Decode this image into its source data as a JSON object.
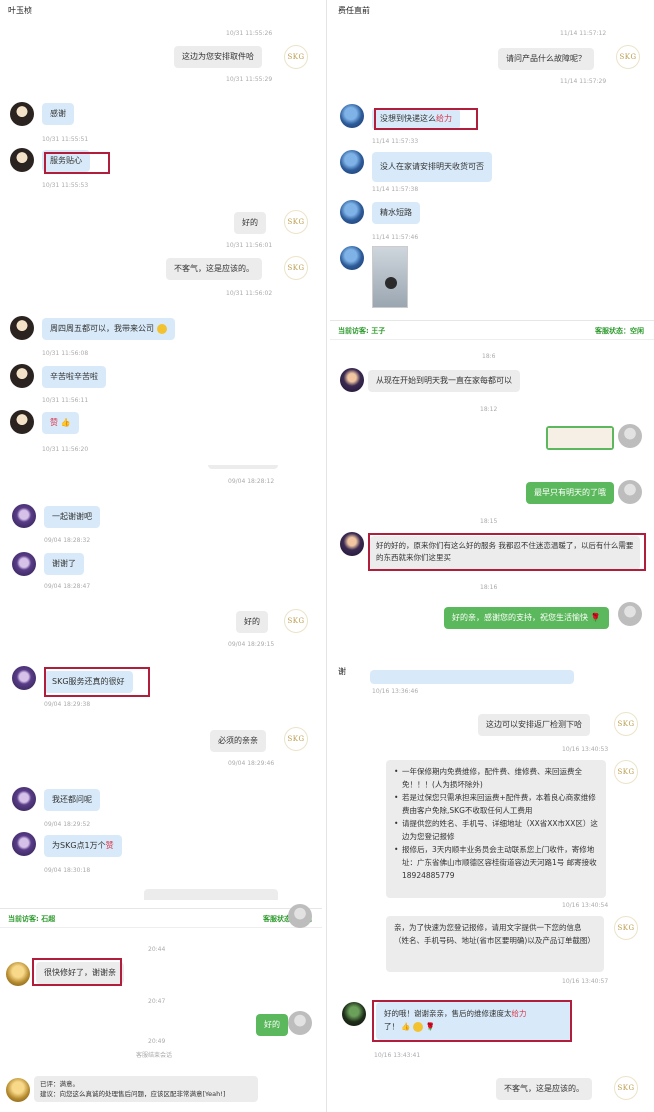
{
  "panel1": {
    "contact": "叶玉桢",
    "messages": [
      {
        "ts": "10/31 11:55:26"
      },
      {
        "text": "这边为您安排取件哈",
        "ts": "10/31 11:55:29"
      },
      {
        "text": "感谢",
        "ts": "10/31 11:55:51"
      },
      {
        "text": "服务贴心",
        "ts": "10/31 11:55:53"
      },
      {
        "text": "好的",
        "ts": "10/31 11:56:01"
      },
      {
        "text": "不客气，这是应该的。",
        "ts": "10/31 11:56:02"
      },
      {
        "text": "周四周五都可以，我带来公司",
        "ts": "10/31 11:56:08"
      },
      {
        "text": "辛苦啦辛苦啦",
        "ts": "10/31 11:56:11"
      },
      {
        "text": "赞",
        "ts": "10/31 11:56:20"
      }
    ]
  },
  "panel2": {
    "messages": [
      {
        "ts": "09/04 18:28:12"
      },
      {
        "text": "一起谢谢吧",
        "ts": "09/04 18:28:32"
      },
      {
        "text": "谢谢了",
        "ts": "09/04 18:28:47"
      },
      {
        "text": "好的",
        "ts": "09/04 18:29:15"
      },
      {
        "text": "SKG服务还真的很好",
        "ts": "09/04 18:29:38"
      },
      {
        "text": "必须的亲亲",
        "ts": "09/04 18:29:46"
      },
      {
        "text": "我还都问呢",
        "ts": "09/04 18:29:52"
      },
      {
        "text_a": "为SKG点1万个",
        "text_b": "赞",
        "ts": "09/04 18:30:18"
      }
    ]
  },
  "panel3": {
    "status_left": "当前访客: 石超",
    "status_right": "客服状态：空闲",
    "messages": [
      {
        "time": "20:44"
      },
      {
        "text": "很快修好了，谢谢亲"
      },
      {
        "time": "20:47"
      },
      {
        "text": "好的"
      },
      {
        "time": "20:49"
      },
      {
        "system": "客服结束会话"
      },
      {
        "line1": "已评：满意。",
        "line2": "建议：向您这么真诚的处理售后问题，应该区配非常满意[Yeah!]"
      }
    ]
  },
  "panel4": {
    "contact": "费任直前",
    "messages": [
      {
        "ts": "11/14 11:57:12"
      },
      {
        "text": "请问产品什么故障呢？",
        "ts": "11/14 11:57:29"
      },
      {
        "text_a": "没想到快递这么",
        "text_b": "给力",
        "ts": "11/14 11:57:33"
      },
      {
        "text": "没人在家请安排明天收货可否",
        "ts": "11/14 11:57:38"
      },
      {
        "text": "精水短路",
        "ts": "11/14 11:57:46"
      }
    ]
  },
  "panel5": {
    "status_left": "当前访客: 王子",
    "status_right": "客服状态：空闲",
    "messages": [
      {
        "time": "18:6"
      },
      {
        "text": "从现在开始到明天我一直在家每都可以"
      },
      {
        "time": "18:12"
      },
      {
        "text": "最早只有明天的了哦"
      },
      {
        "time": "18:15"
      },
      {
        "text": "好的好的，原来你们有这么好的服务 我都忍不住迷恋温暖了，以后有什么需要的东西就来你们这里买"
      },
      {
        "time": "18:16"
      },
      {
        "text": "好的亲，感谢您的支持，祝您生活愉快"
      }
    ]
  },
  "panel6": {
    "contact": "谢",
    "messages": [
      {
        "ts": "10/16 13:36:46"
      },
      {
        "text": "这边可以安排返厂检测下哈",
        "ts": "10/16 13:40:53"
      },
      {
        "items": [
          "一年保修期内免费维修，配件费、维修费、来回运费全免！！！(人为损坏除外)",
          "若是过保您只需承担来回运费+配件费，本着良心商家维修费由客户免除,SKG不收取任何人工费用",
          "请提供您的姓名、手机号、详细地址（XX省XX市XX区）这边为您登记报修",
          "报修后，3天内顺丰业务员会主动联系您上门收件，寄修地址：广东省佛山市顺德区容桂街道容边天河路1号 邮寄接收 18924885779"
        ],
        "ts": "10/16 13:40:54"
      },
      {
        "text": "亲，为了快速为您登记报修，请用文字提供一下您的信息（姓名、手机号码、地址(省市区要明确)以及产品订单截图）",
        "ts": "10/16 13:40:57"
      },
      {
        "text_a": "好的哦！谢谢亲亲，售后的维修速度太",
        "text_b": "给力",
        "text_c": "了！",
        "ts": "10/16 13:43:41"
      },
      {
        "text": "不客气，这是应该的。"
      }
    ]
  },
  "brand_logo": "SKG",
  "colors": {
    "highlight": "#b01e3c",
    "incoming": "#d8eaf9",
    "outgoing": "#ececec",
    "green": "#5cb85c",
    "status": "#2c9a2c"
  }
}
